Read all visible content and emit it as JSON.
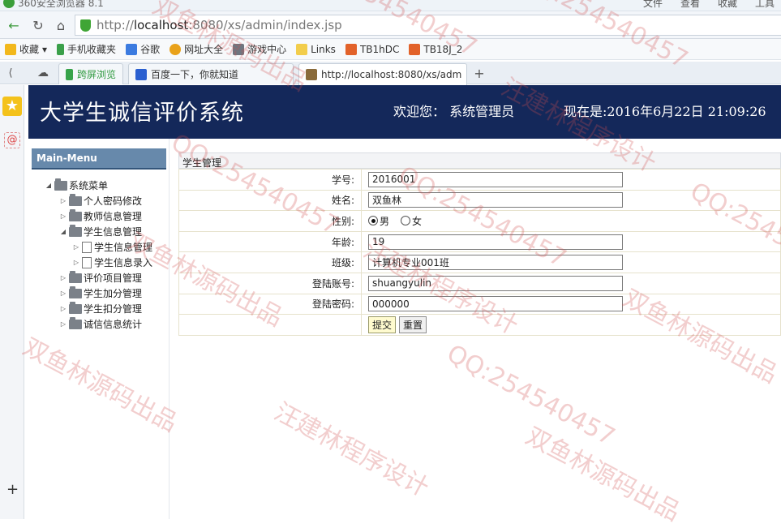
{
  "browser": {
    "app_title": "360安全浏览器 8.1",
    "menus": [
      "文件",
      "查看",
      "收藏",
      "工具"
    ],
    "url_scheme": "http://",
    "url_host": "localhost",
    "url_rest": ":8080/xs/admin/index.jsp",
    "bookmarks": [
      "收藏",
      "手机收藏夹",
      "谷歌",
      "网址大全",
      "游戏中心",
      "Links",
      "TB1hDC",
      "TB18J_2"
    ],
    "tabs": [
      "跨屏浏览",
      "百度一下，你就知道",
      "http://localhost:8080/xs/adm"
    ]
  },
  "banner": {
    "title": "大学生诚信评价系统",
    "welcome": "欢迎您：  系统管理员",
    "now": "现在是:2016年6月22日  21:09:26"
  },
  "sidebar": {
    "menu_title": "Main-Menu",
    "root": "系统菜单",
    "items": [
      {
        "label": "个人密码修改",
        "type": "folder",
        "level": 1,
        "expanded": false
      },
      {
        "label": "教师信息管理",
        "type": "folder",
        "level": 1,
        "expanded": false
      },
      {
        "label": "学生信息管理",
        "type": "folder",
        "level": 1,
        "expanded": true
      },
      {
        "label": "学生信息管理",
        "type": "file",
        "level": 2,
        "expanded": false
      },
      {
        "label": "学生信息录入",
        "type": "file",
        "level": 2,
        "expanded": false
      },
      {
        "label": "评价项目管理",
        "type": "folder",
        "level": 1,
        "expanded": false
      },
      {
        "label": "学生加分管理",
        "type": "folder",
        "level": 1,
        "expanded": false
      },
      {
        "label": "学生扣分管理",
        "type": "folder",
        "level": 1,
        "expanded": false
      },
      {
        "label": "诚信信息统计",
        "type": "folder",
        "level": 1,
        "expanded": false
      }
    ]
  },
  "form": {
    "section_title": "学生管理",
    "fields": [
      {
        "label": "学号:",
        "value": "2016001"
      },
      {
        "label": "姓名:",
        "value": "双鱼林"
      },
      {
        "label": "性别:",
        "value": ""
      },
      {
        "label": "年龄:",
        "value": "19"
      },
      {
        "label": "班级:",
        "value": "计算机专业001班"
      },
      {
        "label": "登陆账号:",
        "value": "shuangyulin"
      },
      {
        "label": "登陆密码:",
        "value": "000000"
      }
    ],
    "gender_options": [
      "男",
      "女"
    ],
    "gender_selected": "男",
    "submit_label": "提交",
    "reset_label": "重置"
  },
  "watermarks": [
    "QQ:254540457",
    "双鱼林源码出品",
    "汪建林程序设计"
  ]
}
